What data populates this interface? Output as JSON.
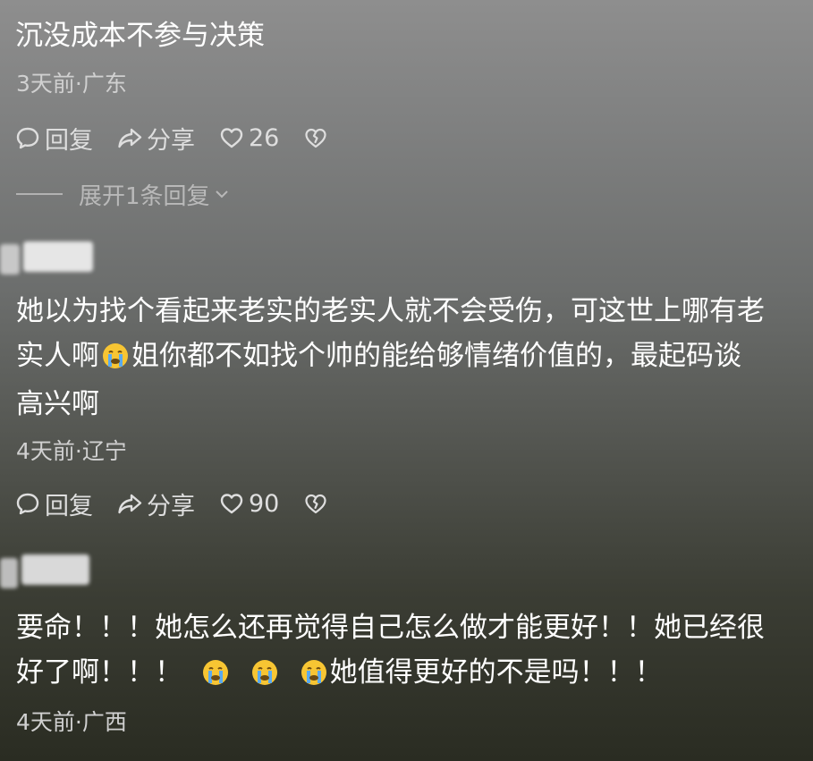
{
  "comments": [
    {
      "text": "沉没成本不参与决策",
      "meta": "3天前·广东",
      "actions": {
        "reply": "回复",
        "share": "分享",
        "likes": "26"
      },
      "expand_label": "展开1条回复"
    },
    {
      "lines": [
        "她以为找个看起来老实的老实人就不会受伤，可这世上哪有老",
        "实人啊",
        "姐你都不如找个帅的能给够情绪价值的，最起码谈",
        "高兴啊"
      ],
      "meta": "4天前·辽宁",
      "actions": {
        "reply": "回复",
        "share": "分享",
        "likes": "90"
      }
    },
    {
      "lines": [
        "要命！！！她怎么还再觉得自己怎么做才能更好！！她已经很",
        "好了啊！！！",
        "她值得更好的不是吗！！！"
      ],
      "meta": "4天前·广西"
    }
  ],
  "icons": {
    "reply": "speech-bubble-icon",
    "share": "share-arrow-icon",
    "like": "heart-icon",
    "dislike": "broken-heart-icon",
    "emoji": "crying-face-emoji"
  },
  "colors": {
    "text": "#ffffff",
    "meta": "#d0d0d0",
    "emoji_face": "#f7c533"
  }
}
